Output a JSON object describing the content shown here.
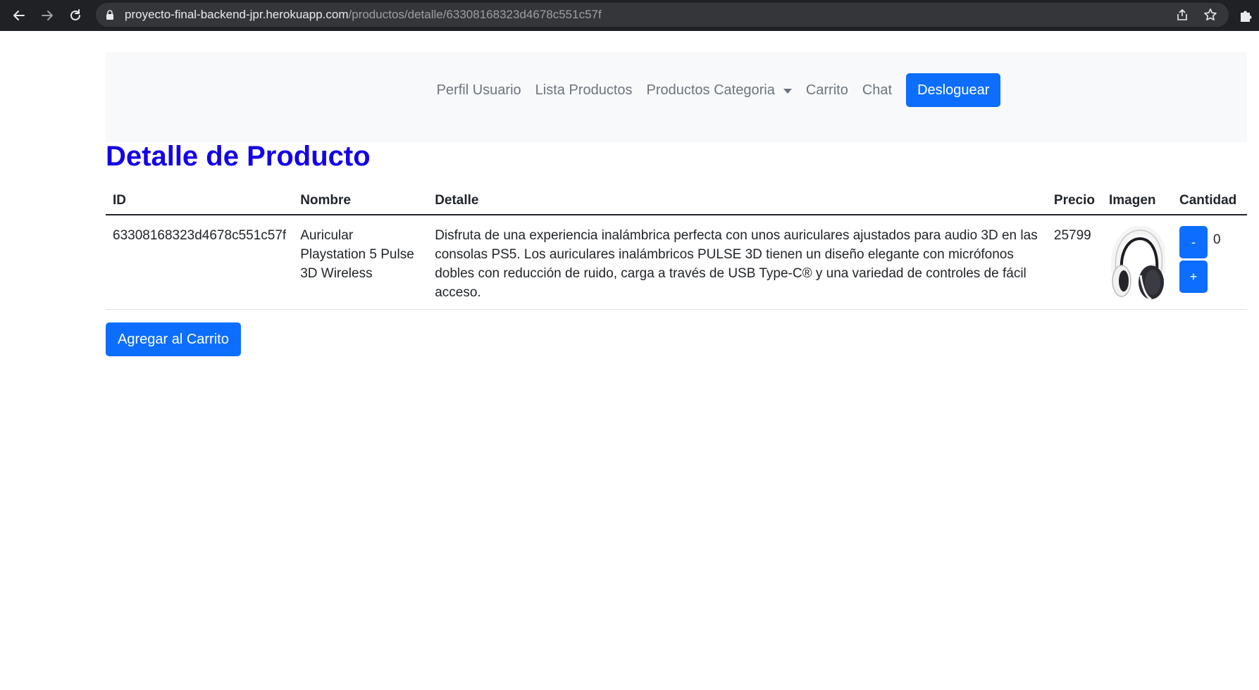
{
  "browser": {
    "url_host": "proyecto-final-backend-jpr.herokuapp.com",
    "url_path": "/productos/detalle/63308168323d4678c551c57f"
  },
  "navbar": {
    "links": [
      "Perfil Usuario",
      "Lista Productos",
      "Productos Categoria",
      "Carrito",
      "Chat"
    ],
    "logout_label": "Desloguear"
  },
  "page": {
    "title": "Detalle de Producto"
  },
  "table": {
    "headers": [
      "ID",
      "Nombre",
      "Detalle",
      "Precio",
      "Imagen",
      "Cantidad"
    ],
    "row": {
      "id": "63308168323d4678c551c57f",
      "nombre": "Auricular Playstation 5 Pulse 3D Wireless",
      "detalle": "Disfruta de una experiencia inalámbrica perfecta con unos auriculares ajustados para audio 3D en las consolas PS5. Los auriculares inalámbricos PULSE 3D tienen un diseño elegante con micrófonos dobles con reducción de ruido, carga a través de USB Type-C® y una variedad de controles de fácil acceso.",
      "precio": "25799",
      "imagen": "headset-image",
      "cantidad": "0",
      "minus_label": "-",
      "plus_label": "+"
    }
  },
  "actions": {
    "add_to_cart_label": "Agregar al Carrito"
  },
  "colors": {
    "primary": "#0d6efd",
    "title": "#1400e6",
    "navbar_bg": "#f8f9fa",
    "nav_link": "#6c757d"
  }
}
